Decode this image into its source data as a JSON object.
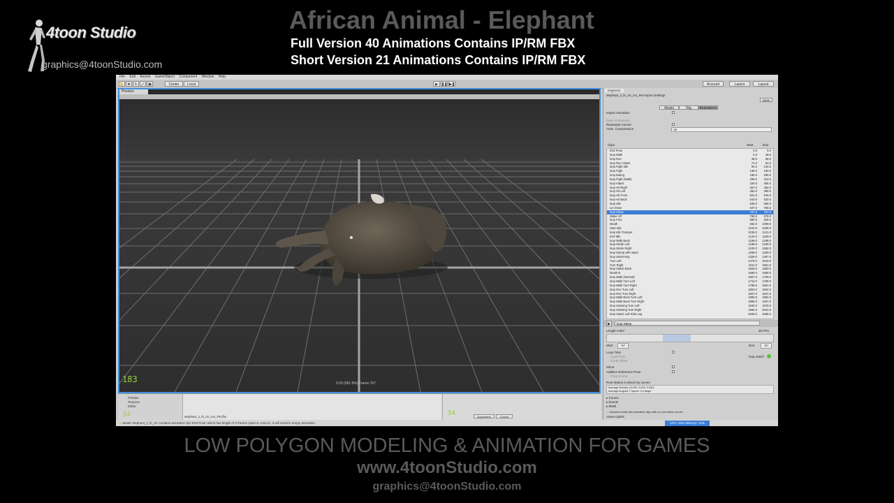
{
  "branding": {
    "studio_name": "4toon Studio",
    "email": "graphics@4toonStudio.com"
  },
  "header": {
    "title": "African Animal - Elephant",
    "subtitle_full": "Full Version 40 Animations Contains IP/RM FBX",
    "subtitle_short": "Short Version 21 Animations Contains IP/RM FBX"
  },
  "app": {
    "menu": [
      "File",
      "Edit",
      "Assets",
      "GameObject",
      "Component",
      "Window",
      "Help"
    ],
    "toolbar": {
      "center_label": "Center",
      "local_label": "Local",
      "account_label": "Account",
      "layers_label": "Layers",
      "layout_label": "Layout"
    },
    "scene": {
      "tab_label": "Preview",
      "caption": "0:29 (061.9%) Frame 767",
      "fps": "183"
    },
    "project": {
      "folders": [
        "Prefabs",
        "Textures",
        "Editor"
      ],
      "file_path": "elephant_ii_fs_rm_ms_FM.fbx",
      "count_left": "34",
      "count_right": "34",
      "btn_dopesheet": "Dopesheet",
      "btn_curves": "Curves"
    },
    "status_text": "Model 'elephant_ii_fs_rm' contains animation clip 'End Pose' which has length of 0 frames (start=0, end=0). It will result in empty animation.",
    "inspector": {
      "tab_label": "Inspector",
      "asset_name": "elephant_ii_fs_rm_ms_FM Import Settings",
      "open_label": "Open",
      "tabs": [
        "Model",
        "Rig",
        "Animations"
      ],
      "import_animation": "Import Animation",
      "bake_animations": "Bake Animations",
      "resample_curves": "Resample Curves",
      "anim_compression": "Anim. Compression",
      "anim_compression_value": "Off",
      "clips_header": "Clips",
      "col_start": "Start",
      "col_end": "End",
      "clips": [
        {
          "name": "End Pose",
          "start": "0.0",
          "end": "0.0"
        },
        {
          "name": "loop Walk",
          "start": "2.0",
          "end": "48.0"
        },
        {
          "name": "loop Run",
          "start": "48.0",
          "end": "69.0"
        },
        {
          "name": "loop Run Attack",
          "start": "71.0",
          "end": "91.0"
        },
        {
          "name": "loop Fight Idle",
          "start": "94.0",
          "end": "134.0"
        },
        {
          "name": "loop Fight",
          "start": "136.0",
          "end": "192.0"
        },
        {
          "name": "loop Eating",
          "start": "195.0",
          "end": "296.0"
        },
        {
          "name": "loop Fight (Walk)",
          "start": "299.0",
          "end": "413.0"
        },
        {
          "name": "loop Attack",
          "start": "425.0",
          "end": "465.0"
        },
        {
          "name": "loop Hit Right",
          "start": "467.0",
          "end": "482.0"
        },
        {
          "name": "loop Hit Left",
          "start": "484.0",
          "end": "499.0"
        },
        {
          "name": "loop Hit Front",
          "start": "501.0",
          "end": "516.0"
        },
        {
          "name": "loop Hit Back",
          "start": "518.0",
          "end": "533.0"
        },
        {
          "name": "loop Idle",
          "start": "536.0",
          "end": "636.0"
        },
        {
          "name": "Lie Down",
          "start": "637.0",
          "end": "766.0"
        },
        {
          "name": "loop Sleep",
          "start": "767.0",
          "end": "787.0"
        },
        {
          "name": "Wake UP",
          "start": "788.0",
          "end": "878.0"
        },
        {
          "name": "loop Free",
          "start": "880.0",
          "end": "929.0"
        },
        {
          "name": "Death",
          "start": "932.0",
          "end": "1009.0"
        },
        {
          "name": "Start Idle",
          "start": "1010.0",
          "end": "1035.0"
        },
        {
          "name": "loop Idle Trumpet",
          "start": "1036.0",
          "end": "1121.0"
        },
        {
          "name": "End Idle",
          "start": "1122.0",
          "end": "1150.0"
        },
        {
          "name": "loop Walk Back",
          "start": "1159.0",
          "end": "1198.0"
        },
        {
          "name": "loop Strafe Left",
          "start": "1199.0",
          "end": "1239.0"
        },
        {
          "name": "loop Strafe Right",
          "start": "1240.0",
          "end": "1282.0"
        },
        {
          "name": "loop Stomp with water",
          "start": "1285.0",
          "end": "1425.0"
        },
        {
          "name": "loop Swimming",
          "start": "1428.0",
          "end": "1467.0"
        },
        {
          "name": "Turn Left",
          "start": "1470.0",
          "end": "1510.0"
        },
        {
          "name": "Turn Right",
          "start": "1511.0",
          "end": "1551.0"
        },
        {
          "name": "loop Attack Back",
          "start": "1553.0",
          "end": "1593.0"
        },
        {
          "name": "Death B",
          "start": "1595.0",
          "end": "1665.0"
        },
        {
          "name": "loop Walk (Normal)",
          "start": "1667.0",
          "end": "1709.0"
        },
        {
          "name": "loop Walk Turn Left",
          "start": "1712.0",
          "end": "1759.0"
        },
        {
          "name": "loop Walk Turn Right",
          "start": "1788.0",
          "end": "1801.0"
        },
        {
          "name": "loop Run Turn Left",
          "start": "1804.0",
          "end": "1824.0"
        },
        {
          "name": "loop Run Turn Right",
          "start": "1827.0",
          "end": "1847.0"
        },
        {
          "name": "loop Walk Back Turn Left",
          "start": "1850.0",
          "end": "1892.0"
        },
        {
          "name": "loop Walk Back Turn Right",
          "start": "1895.0",
          "end": "1937.0"
        },
        {
          "name": "loop Swiming Turn Left",
          "start": "1940.0",
          "end": "1979.0"
        },
        {
          "name": "loop Swiming Turn Right",
          "start": "1982.0",
          "end": "2022.0"
        },
        {
          "name": "loop Attack Left Side Leg",
          "start": "2026.0",
          "end": "2066.0"
        }
      ],
      "selected_clip": "loop Sleep",
      "length_label": "Length",
      "length_value": "0.667",
      "fps_value": "30 FPS",
      "start_label": "Start",
      "start_value": "767",
      "end_label": "End",
      "end_value": "787",
      "loop_time": "Loop Time",
      "loop_pose": "Loop Pose",
      "cycle_offset": "Cycle Offset",
      "loop_match": "loop match",
      "mirror": "Mirror",
      "additive_ref": "Additive Reference Pose",
      "pose_frame": "Pose Frame",
      "root_motion": "Root Motion is driven by curves",
      "avg_velocity": "Average Velocity: (0.000, 0.000, 0.000)",
      "avg_angular": "Average Angular Y Speed: 0.0 deg/s",
      "sections": [
        "Curves",
        "Events",
        "Mask"
      ],
      "warning": "Imported model has animation clips with no root motion curves.",
      "asset_labels": "Asset Labels",
      "cpu_label": "CPU: 23%  Memory: 12%"
    }
  },
  "footer": {
    "line1": "LOW POLYGON MODELING & ANIMATION FOR GAMES",
    "line2": "www.4toonStudio.com",
    "line3": "graphics@4toonStudio.com"
  },
  "colors": {
    "accent": "#3d7ed6",
    "title_gray": "#5a5a5a",
    "fps_green": "#9ad03c"
  }
}
